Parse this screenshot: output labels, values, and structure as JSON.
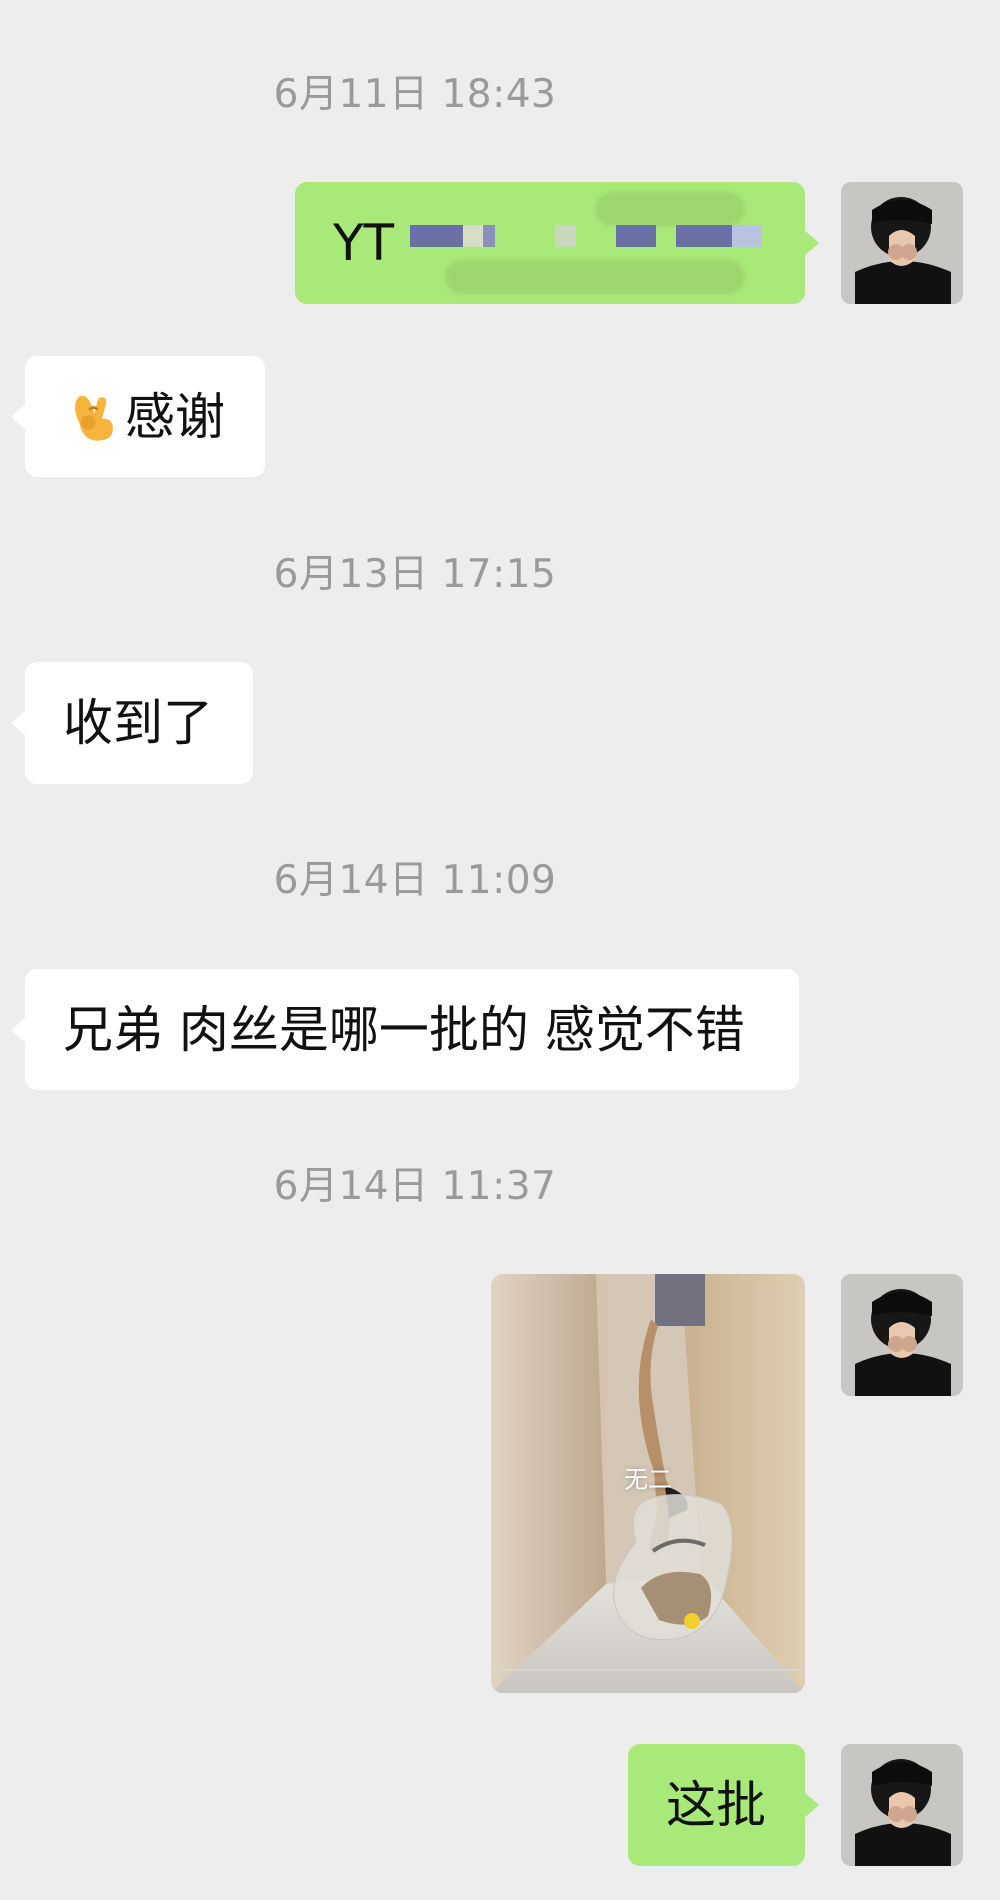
{
  "app": {
    "name": "WeChat chat",
    "colors": {
      "background": "#ededed",
      "incoming_bubble": "#ffffff",
      "outgoing_bubble": "#a9e97a",
      "timestamp": "#9a9a9a"
    }
  },
  "messages": [
    {
      "id": "t1",
      "type": "timestamp",
      "text": "6月11日 18:43"
    },
    {
      "id": "m1",
      "type": "outgoing_text",
      "text": "YT",
      "avatar_icon": "avatar-icon",
      "redacted": true
    },
    {
      "id": "m2",
      "type": "incoming_text",
      "emoji_icon": "ok-hand-emoji-icon",
      "text": "感谢"
    },
    {
      "id": "t2",
      "type": "timestamp",
      "text": "6月13日 17:15"
    },
    {
      "id": "m3",
      "type": "incoming_text",
      "text": "收到了"
    },
    {
      "id": "t3",
      "type": "timestamp",
      "text": "6月14日 11:09"
    },
    {
      "id": "m4",
      "type": "incoming_text",
      "text": "兄弟 肉丝是哪一批的 感觉不错"
    },
    {
      "id": "t4",
      "type": "timestamp",
      "text": "6月14日 11:37"
    },
    {
      "id": "m5",
      "type": "outgoing_image",
      "image_icon": "photo-icon",
      "overlay_text": "无二",
      "avatar_icon": "avatar-icon"
    },
    {
      "id": "m6",
      "type": "outgoing_text",
      "text": "这批",
      "avatar_icon": "avatar-icon"
    }
  ]
}
